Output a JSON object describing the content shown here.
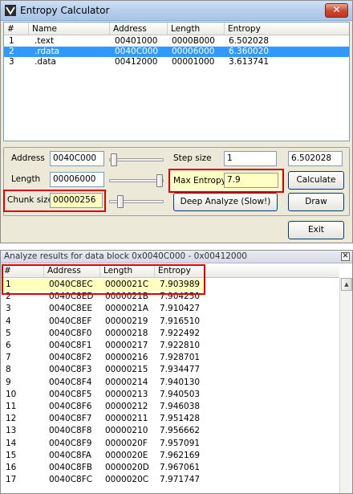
{
  "window": {
    "title": "Entropy Calculator",
    "close_glyph": "✕"
  },
  "sections": {
    "columns": [
      "#",
      "Name",
      "Address",
      "Length",
      "Entropy"
    ],
    "rows": [
      {
        "num": "1",
        "name": ".text",
        "address": "00401000",
        "length": "0000B000",
        "entropy": "6.502028",
        "selected": false
      },
      {
        "num": "2",
        "name": ".rdata",
        "address": "0040C000",
        "length": "00006000",
        "entropy": "6.360020",
        "selected": true
      },
      {
        "num": "3",
        "name": ".data",
        "address": "00412000",
        "length": "00001000",
        "entropy": "3.613741",
        "selected": false
      }
    ]
  },
  "controls": {
    "address_label": "Address",
    "address_value": "0040C000",
    "length_label": "Length",
    "length_value": "00006000",
    "chunk_label": "Chunk size",
    "chunk_value": "00000256",
    "step_label": "Step size",
    "step_value": "1",
    "entropy_display": "6.502028",
    "max_entropy_label": "Max Entropy",
    "max_entropy_value": "7.9",
    "calculate_label": "Calculate",
    "deep_analyze_label": "Deep Analyze (Slow!)",
    "draw_label": "Draw",
    "exit_label": "Exit"
  },
  "results": {
    "title": "Analyze results for data block 0x0040C000 - 0x00412000",
    "close_glyph": "✕",
    "columns": [
      "#",
      "Address",
      "Length",
      "Entropy"
    ],
    "rows": [
      {
        "num": "1",
        "address": "0040C8EC",
        "length": "0000021C",
        "entropy": "7.903989"
      },
      {
        "num": "2",
        "address": "0040C8ED",
        "length": "0000021B",
        "entropy": "7.904250"
      },
      {
        "num": "3",
        "address": "0040C8EE",
        "length": "0000021A",
        "entropy": "7.910427"
      },
      {
        "num": "4",
        "address": "0040C8EF",
        "length": "00000219",
        "entropy": "7.916510"
      },
      {
        "num": "5",
        "address": "0040C8F0",
        "length": "00000218",
        "entropy": "7.922492"
      },
      {
        "num": "6",
        "address": "0040C8F1",
        "length": "00000217",
        "entropy": "7.922810"
      },
      {
        "num": "7",
        "address": "0040C8F2",
        "length": "00000216",
        "entropy": "7.928701"
      },
      {
        "num": "8",
        "address": "0040C8F3",
        "length": "00000215",
        "entropy": "7.934477"
      },
      {
        "num": "9",
        "address": "0040C8F4",
        "length": "00000214",
        "entropy": "7.940130"
      },
      {
        "num": "10",
        "address": "0040C8F5",
        "length": "00000213",
        "entropy": "7.940503"
      },
      {
        "num": "11",
        "address": "0040C8F6",
        "length": "00000212",
        "entropy": "7.946038"
      },
      {
        "num": "12",
        "address": "0040C8F7",
        "length": "00000211",
        "entropy": "7.951428"
      },
      {
        "num": "13",
        "address": "0040C8F8",
        "length": "00000210",
        "entropy": "7.956662"
      },
      {
        "num": "14",
        "address": "0040C8F9",
        "length": "0000020F",
        "entropy": "7.957091"
      },
      {
        "num": "15",
        "address": "0040C8FA",
        "length": "0000020E",
        "entropy": "7.962169"
      },
      {
        "num": "16",
        "address": "0040C8FB",
        "length": "0000020D",
        "entropy": "7.967061"
      },
      {
        "num": "17",
        "address": "0040C8FC",
        "length": "0000020C",
        "entropy": "7.971747"
      }
    ]
  }
}
